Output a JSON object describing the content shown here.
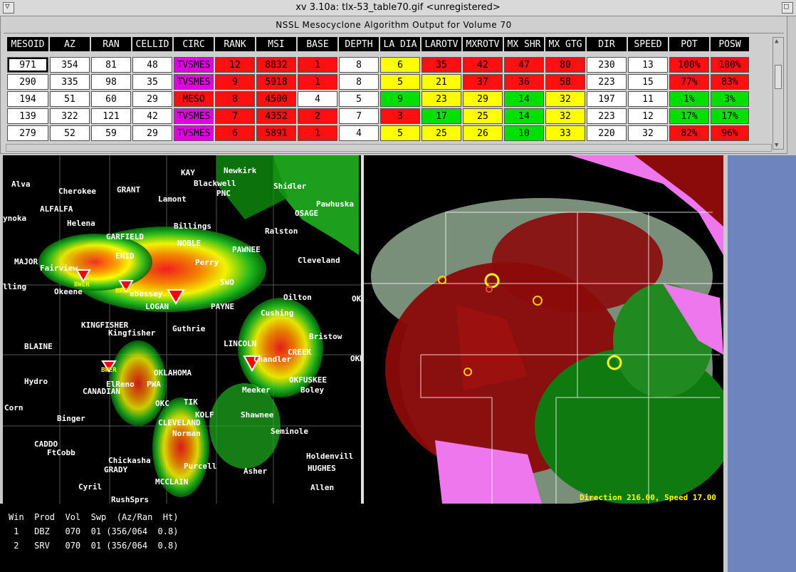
{
  "window": {
    "title": "xv 3.10a: tlx-53_table70.gif <unregistered>"
  },
  "panel": {
    "title": "NSSL Mesocyclone Algorithm Output for Volume 70",
    "headers": [
      "MESOID",
      "AZ",
      "RAN",
      "CELLID",
      "CIRC",
      "RANK",
      "MSI",
      "BASE",
      "DEPTH",
      "LA DIA",
      "LAROTV",
      "MXROTV",
      "MX SHR",
      "MX GTG",
      "DIR",
      "SPEED",
      "POT",
      "POSW"
    ],
    "rows": [
      {
        "cells": [
          "971",
          "354",
          "81",
          "48",
          "TVSMES",
          "12",
          "8832",
          "1",
          "8",
          "6",
          "35",
          "42",
          "47",
          "80",
          "230",
          "13",
          "100%",
          "100%"
        ],
        "colors": [
          "sel",
          "w",
          "w",
          "w",
          "mag",
          "red",
          "red",
          "red",
          "w",
          "yel",
          "red",
          "red",
          "red",
          "red",
          "w",
          "w",
          "red",
          "red"
        ]
      },
      {
        "cells": [
          "290",
          "335",
          "98",
          "35",
          "TVSMES",
          "9",
          "5918",
          "1",
          "8",
          "5",
          "21",
          "37",
          "36",
          "58",
          "223",
          "15",
          "77%",
          "83%"
        ],
        "colors": [
          "w",
          "w",
          "w",
          "w",
          "mag",
          "red",
          "red",
          "red",
          "w",
          "yel",
          "yel",
          "red",
          "red",
          "red",
          "w",
          "w",
          "red",
          "red"
        ]
      },
      {
        "cells": [
          "194",
          "51",
          "60",
          "29",
          "MESO",
          "8",
          "4500",
          "4",
          "5",
          "9",
          "23",
          "29",
          "14",
          "32",
          "197",
          "11",
          "1%",
          "3%"
        ],
        "colors": [
          "w",
          "w",
          "w",
          "w",
          "red",
          "red",
          "red",
          "w",
          "w",
          "grn",
          "yel",
          "yel",
          "grn",
          "yel",
          "w",
          "w",
          "grn",
          "grn"
        ]
      },
      {
        "cells": [
          "139",
          "322",
          "121",
          "42",
          "TVSMES",
          "7",
          "4352",
          "2",
          "7",
          "3",
          "17",
          "25",
          "14",
          "32",
          "223",
          "12",
          "17%",
          "17%"
        ],
        "colors": [
          "w",
          "w",
          "w",
          "w",
          "mag",
          "red",
          "red",
          "red",
          "w",
          "red",
          "grn",
          "yel",
          "grn",
          "yel",
          "w",
          "w",
          "grn",
          "grn"
        ]
      },
      {
        "cells": [
          "279",
          "52",
          "59",
          "29",
          "TVSMES",
          "6",
          "5891",
          "1",
          "4",
          "5",
          "25",
          "26",
          "10",
          "33",
          "220",
          "32",
          "82%",
          "96%"
        ],
        "colors": [
          "w",
          "w",
          "w",
          "w",
          "mag",
          "red",
          "red",
          "red",
          "w",
          "yel",
          "yel",
          "yel",
          "grn",
          "yel",
          "w",
          "w",
          "red",
          "red"
        ]
      }
    ]
  },
  "colors": {
    "w": "#ffffff",
    "sel": "#ffffff",
    "mag": "#e000e0",
    "red": "#ff1010",
    "yel": "#ffff00",
    "grn": "#00e000"
  },
  "left_map": {
    "towns": [
      "Alva",
      "Cherokee",
      "GRANT",
      "KAY",
      "Newkirk",
      "Blackwell",
      "PNC",
      "Shidler",
      "Pawhuska",
      "OSAGE",
      "Lamont",
      "ALFALFA",
      "Helena",
      "ynoka",
      "GARFIELD",
      "ENID",
      "NOBLE",
      "Billings",
      "Ralston",
      "PAWNEE",
      "Perry",
      "MAJOR",
      "Fairview",
      "Cleveland",
      "lling",
      "Okeene",
      "BWER",
      "BWER",
      "ebessey",
      "SWO",
      "LOGAN",
      "PAYNE",
      "Oilton",
      "Cushing",
      "KINGFISHER",
      "Kingfisher",
      "Guthrie",
      "Bristow",
      "LINCOLN",
      "CREEK",
      "BLAINE",
      "Chandler",
      "OKLAHOMA",
      "BWER",
      "Hydro",
      "ElReno",
      "PWA",
      "OKFUSKEE",
      "Boley",
      "Meeker",
      "CANADIAN",
      "OKC",
      "TIK",
      "Corn",
      "KOLF",
      "Shawnee",
      "Binger",
      "CLEVELAND",
      "Norman",
      "Seminole",
      "CADDO",
      "FtCobb",
      "Holdenvill",
      "Chickasha",
      "Purcell",
      "HUGHES",
      "GRADY",
      "Asher",
      "MCCLAIN",
      "Allen",
      "Cyril",
      "RushSprs",
      "OKM",
      "OKE"
    ]
  },
  "right_map": {
    "status": "Direction 216.00, Speed 17.00"
  },
  "info": {
    "header": "Win  Prod  Vol  Swp  (Az/Ran  Ht)",
    "lines": [
      " 1   DBZ   070  01 (356/064  0.8)",
      " 2   SRV   070  01 (356/064  0.8)"
    ]
  }
}
